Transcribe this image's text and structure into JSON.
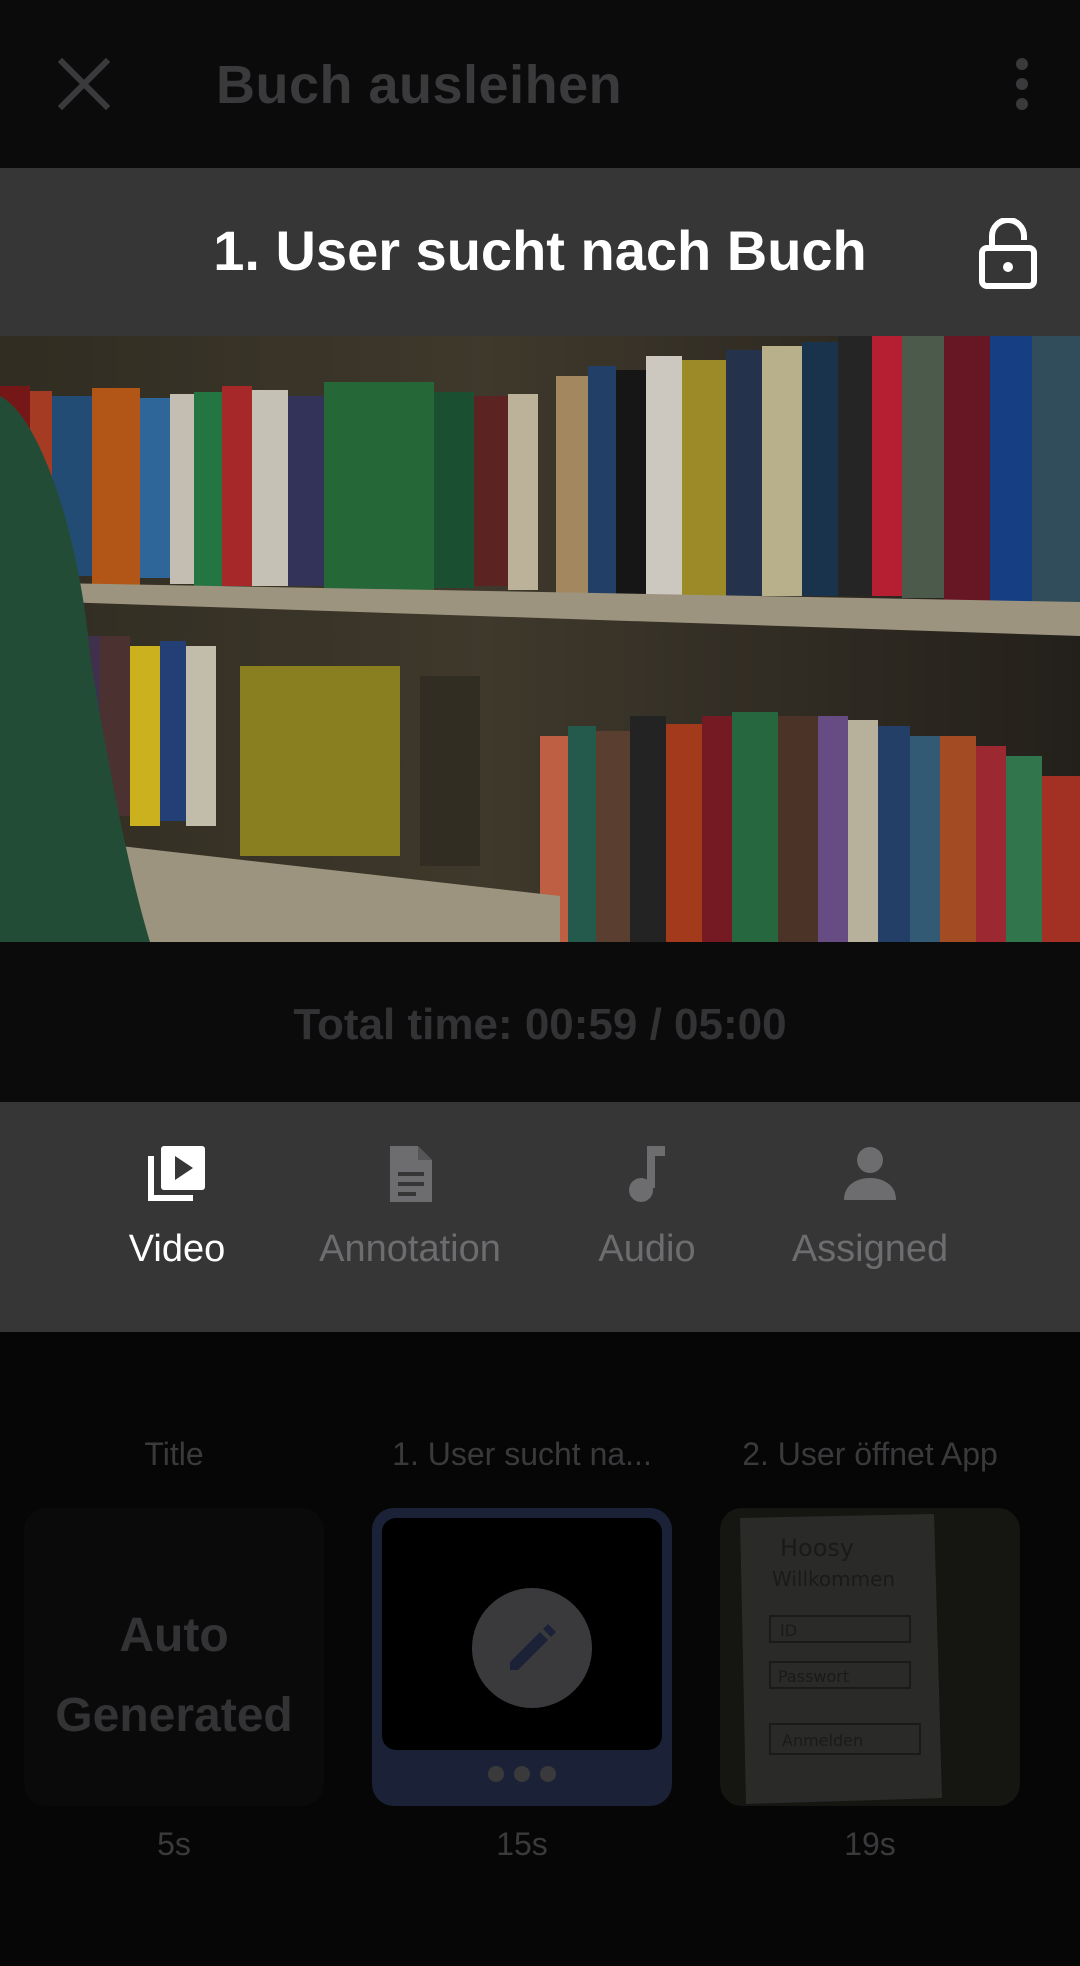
{
  "topbar": {
    "title": "Buch ausleihen",
    "close_icon": "close-icon",
    "more_icon": "more-vert-icon"
  },
  "scene": {
    "title": "1. User sucht nach Buch",
    "lock_icon": "lock-open-icon"
  },
  "video": {
    "content": "library-bookshelf-video-frame"
  },
  "time": {
    "total": "Total time: 00:59 / 05:00"
  },
  "tabs": [
    {
      "label": "Video",
      "icon": "video-library-icon",
      "active": true
    },
    {
      "label": "Annotation",
      "icon": "document-icon",
      "active": false
    },
    {
      "label": "Audio",
      "icon": "music-note-icon",
      "active": false
    },
    {
      "label": "Assigned",
      "icon": "person-icon",
      "active": false
    }
  ],
  "strip": {
    "cards": [
      {
        "label": "Title",
        "duration": "5s",
        "line1": "Auto",
        "line2": "Generated"
      },
      {
        "label": "1. User sucht na...",
        "duration": "15s",
        "icon": "edit-icon"
      },
      {
        "label": "2. User öffnet App",
        "duration": "19s",
        "sketch": {
          "heading1": "Hoosy",
          "heading2": "Willkommen",
          "field1": "ID",
          "field2": "Passwort",
          "button": "Anmelden"
        }
      }
    ]
  },
  "colors": {
    "active_text": "#ffffff",
    "inactive_text": "#6d6d70",
    "header_bg": "#363637",
    "selected_border": "#1b2238"
  }
}
